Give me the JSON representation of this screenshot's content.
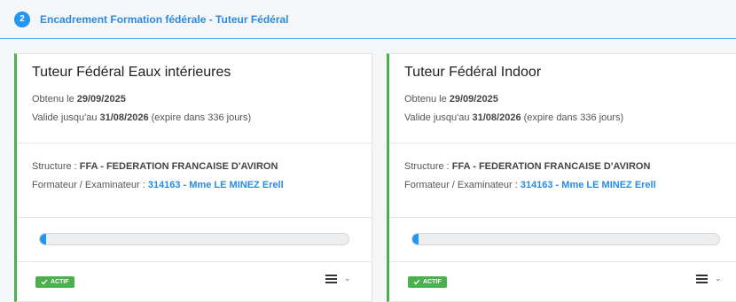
{
  "section": {
    "step": "2",
    "title": "Encadrement Formation fédérale - Tuteur Fédéral"
  },
  "cards": [
    {
      "title": "Tuteur Fédéral Eaux intérieures",
      "obtained_prefix": "Obtenu le ",
      "obtained_date": "29/09/2025",
      "valid_prefix": "Valide jusqu'au ",
      "valid_date": "31/08/2026",
      "valid_suffix": " (expire dans 336 jours)",
      "structure_prefix": "Structure : ",
      "structure": "FFA - FEDERATION FRANCAISE D'AVIRON",
      "formateur_prefix": "Formateur / Examinateur : ",
      "formateur": "314163 - Mme LE MINEZ Erell",
      "progress": 0.02,
      "status": "ACTIF"
    },
    {
      "title": "Tuteur Fédéral Indoor",
      "obtained_prefix": "Obtenu le ",
      "obtained_date": "29/09/2025",
      "valid_prefix": "Valide jusqu'au ",
      "valid_date": "31/08/2026",
      "valid_suffix": " (expire dans 336 jours)",
      "structure_prefix": "Structure : ",
      "structure": "FFA - FEDERATION FRANCAISE D'AVIRON",
      "formateur_prefix": "Formateur / Examinateur : ",
      "formateur": "314163 - Mme LE MINEZ Erell",
      "progress": 0.02,
      "status": "ACTIF"
    }
  ],
  "colors": {
    "accent": "#2196f3",
    "success": "#4caf50"
  },
  "icons": {
    "check": "check-icon",
    "menu": "menu-icon",
    "chevron": "chevron-down-icon"
  }
}
